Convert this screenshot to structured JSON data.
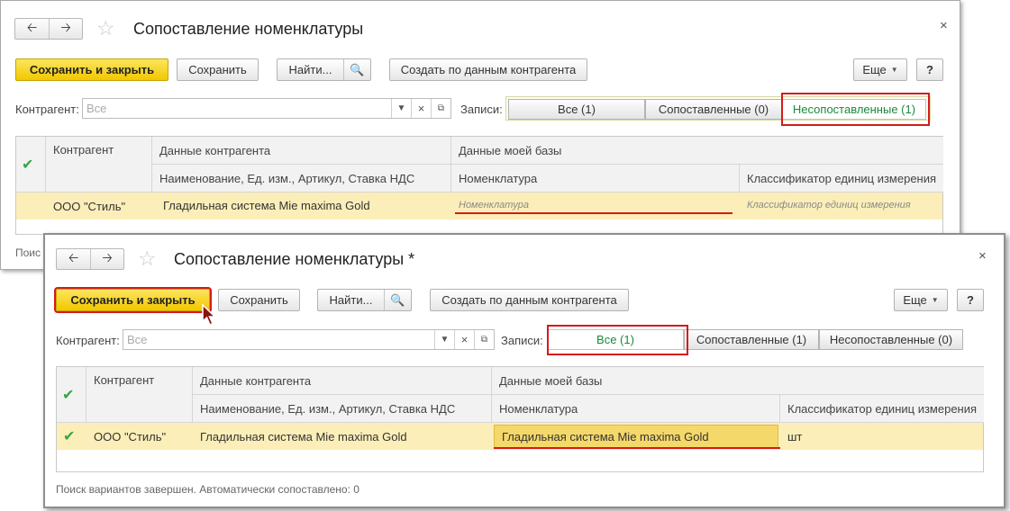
{
  "window1": {
    "title": "Сопоставление номенклатуры",
    "toolbar": {
      "save_close": "Сохранить и закрыть",
      "save": "Сохранить",
      "find": "Найти...",
      "create": "Создать по данным контрагента",
      "more": "Еще",
      "help": "?"
    },
    "filter": {
      "counterparty_label": "Контрагент:",
      "counterparty_placeholder": "Все",
      "records_label": "Записи:",
      "tabs": [
        "Все (1)",
        "Сопоставленные (0)",
        "Несопоставленные (1)"
      ],
      "active_tab": 2
    },
    "table": {
      "headers": {
        "counterparty": "Контрагент",
        "cp_data": "Данные контрагента",
        "cp_data_sub": "Наименование, Ед. изм., Артикул, Ставка НДС",
        "my_data": "Данные моей базы",
        "nomenclature": "Номенклатура",
        "unit_classifier": "Классификатор единиц измерения"
      },
      "rows": [
        {
          "checked": false,
          "counterparty": "ООО \"Стиль\"",
          "cp_name": "Гладильная система Mie maxima Gold",
          "nomenclature": "Номенклатура",
          "unit": "Классификатор единиц измерения"
        }
      ]
    },
    "status_partial": "Поис"
  },
  "window2": {
    "title": "Сопоставление номенклатуры *",
    "toolbar": {
      "save_close": "Сохранить и закрыть",
      "save": "Сохранить",
      "find": "Найти...",
      "create": "Создать по данным контрагента",
      "more": "Еще",
      "help": "?"
    },
    "filter": {
      "counterparty_label": "Контрагент:",
      "counterparty_placeholder": "Все",
      "records_label": "Записи:",
      "tabs": [
        "Все (1)",
        "Сопоставленные (1)",
        "Несопоставленные (0)"
      ],
      "active_tab": 0
    },
    "table": {
      "headers": {
        "counterparty": "Контрагент",
        "cp_data": "Данные контрагента",
        "cp_data_sub": "Наименование, Ед. изм., Артикул, Ставка НДС",
        "my_data": "Данные моей базы",
        "nomenclature": "Номенклатура",
        "unit_classifier": "Классификатор единиц измерения"
      },
      "rows": [
        {
          "checked": true,
          "counterparty": "ООО \"Стиль\"",
          "cp_name": "Гладильная система Mie maxima Gold",
          "nomenclature": "Гладильная система Mie maxima Gold",
          "unit": "шт"
        }
      ]
    },
    "status": "Поиск вариантов завершен. Автоматически сопоставлено: 0"
  },
  "colors": {
    "accent_yellow": "#f5cf1a",
    "highlight_red": "#d61a1a",
    "row_highlight": "#fbeeb8",
    "check_green": "#3aa34a"
  }
}
